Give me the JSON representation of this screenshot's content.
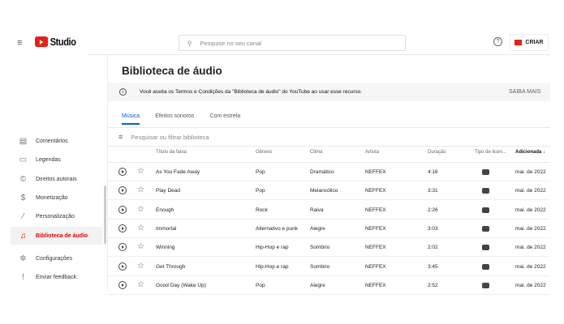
{
  "header": {
    "logo_text": "Studio",
    "search_placeholder": "Pesquise no seu canal",
    "create_label": "CRIAR"
  },
  "sidebar": {
    "items": [
      {
        "label": "Comentários",
        "icon": "comment-icon"
      },
      {
        "label": "Legendas",
        "icon": "subtitles-icon"
      },
      {
        "label": "Direitos autorais",
        "icon": "copyright-icon"
      },
      {
        "label": "Monetização",
        "icon": "dollar-icon"
      },
      {
        "label": "Personalização",
        "icon": "magic-wand-icon"
      },
      {
        "label": "Biblioteca de áudio",
        "icon": "audio-library-icon",
        "active": true
      },
      {
        "label": "Configurações",
        "icon": "gear-icon"
      },
      {
        "label": "Enviar feedback",
        "icon": "feedback-icon"
      }
    ]
  },
  "main": {
    "title": "Biblioteca de áudio",
    "banner": {
      "text": "Você aceita os Termos e Condições da \"Biblioteca de áudio\" do YouTube ao usar esse recurso.",
      "link": "SAIBA MAIS"
    },
    "tabs": [
      {
        "label": "Música",
        "active": true
      },
      {
        "label": "Efeitos sonoros"
      },
      {
        "label": "Com estrela"
      }
    ],
    "filter_placeholder": "Pesquisar ou filtrar biblioteca",
    "columns": [
      "Título da faixa",
      "Gênero",
      "Clima",
      "Artista",
      "Duração",
      "Tipo de licen...",
      "Adicionada ↓"
    ],
    "rows": [
      [
        "As You Fade Away",
        "Pop",
        "Dramático",
        "NEFFEX",
        "4:16",
        "mai. de 2022"
      ],
      [
        "Play Dead",
        "Pop",
        "Melancólico",
        "NEFFEX",
        "3:31",
        "mai. de 2022"
      ],
      [
        "Enough",
        "Rock",
        "Raiva",
        "NEFFEX",
        "2:26",
        "mai. de 2022"
      ],
      [
        "Immortal",
        "Alternativo e punk",
        "Alegre",
        "NEFFEX",
        "3:03",
        "mai. de 2022"
      ],
      [
        "Winning",
        "Hip-Hop e rap",
        "Sombrio",
        "NEFFEX",
        "2:02",
        "mai. de 2022"
      ],
      [
        "Get Through",
        "Hip-Hop e rap",
        "Sombrio",
        "NEFFEX",
        "3:45",
        "mai. de 2022"
      ],
      [
        "Good Day (Wake Up)",
        "Pop",
        "Alegre",
        "NEFFEX",
        "2:52",
        "mai. de 2022"
      ]
    ]
  },
  "colors": {
    "accent": "#065fd4",
    "brand": "#e62117",
    "active": "#dd0000"
  }
}
